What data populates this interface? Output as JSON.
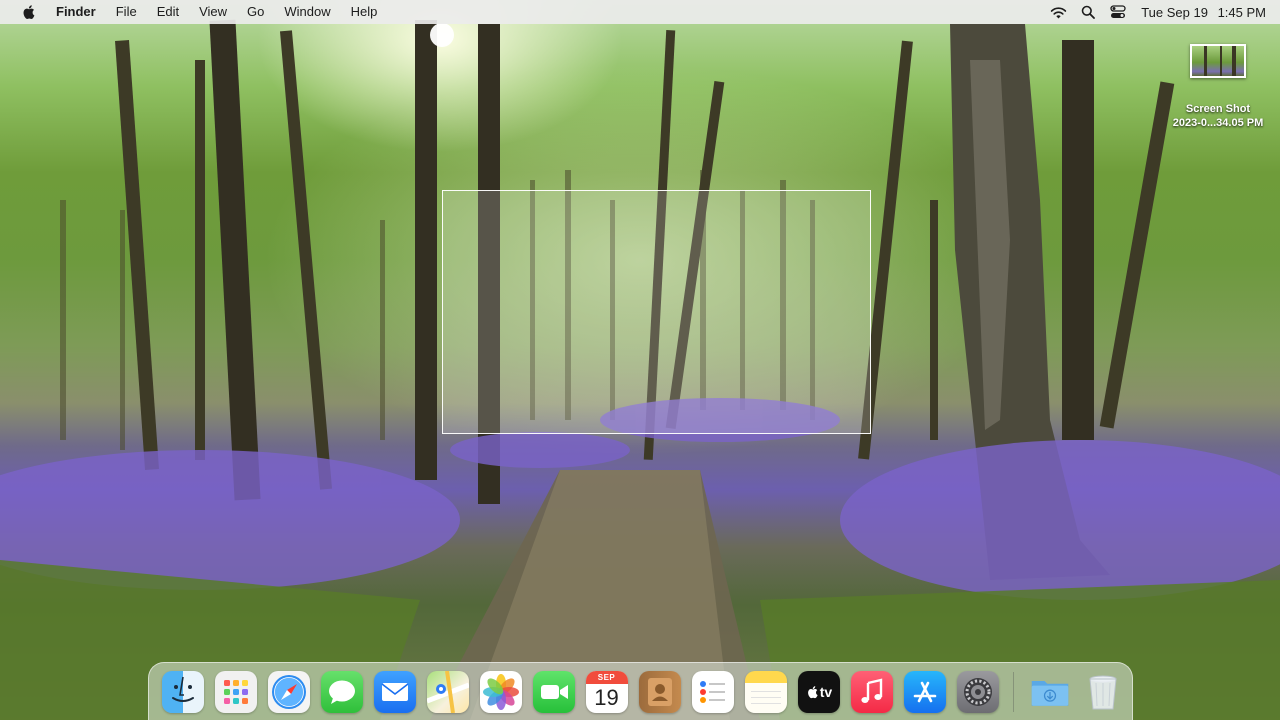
{
  "menubar": {
    "apple_icon": "apple-logo-icon",
    "app_name": "Finder",
    "menus": [
      "File",
      "Edit",
      "View",
      "Go",
      "Window",
      "Help"
    ],
    "status_icons": [
      "wifi-icon",
      "search-icon",
      "control-center-icon"
    ],
    "date": "Tue Sep 19",
    "time": "1:45 PM"
  },
  "desktop": {
    "file": {
      "icon": "screenshot-thumbnail-icon",
      "label_line1": "Screen Shot",
      "label_line2": "2023-0...34.05 PM"
    }
  },
  "dock": {
    "apps": [
      {
        "id": "finder",
        "icon": "finder-icon"
      },
      {
        "id": "launchpad",
        "icon": "launchpad-icon"
      },
      {
        "id": "safari",
        "icon": "safari-icon"
      },
      {
        "id": "messages",
        "icon": "messages-icon"
      },
      {
        "id": "mail",
        "icon": "mail-icon"
      },
      {
        "id": "maps",
        "icon": "maps-icon"
      },
      {
        "id": "photos",
        "icon": "photos-icon"
      },
      {
        "id": "facetime",
        "icon": "facetime-icon"
      },
      {
        "id": "calendar",
        "icon": "calendar-icon"
      },
      {
        "id": "contacts",
        "icon": "contacts-icon"
      },
      {
        "id": "reminders",
        "icon": "reminders-icon"
      },
      {
        "id": "notes",
        "icon": "notes-icon"
      },
      {
        "id": "tv",
        "icon": "apple-tv-icon"
      },
      {
        "id": "music",
        "icon": "music-icon"
      },
      {
        "id": "appstore",
        "icon": "app-store-icon"
      },
      {
        "id": "settings",
        "icon": "system-settings-icon"
      }
    ],
    "calendar": {
      "month": "SEP",
      "day": "19"
    },
    "tv_label": "tv",
    "downloads_icon": "downloads-folder-icon",
    "trash_icon": "trash-icon"
  },
  "colors": {
    "menubar_bg": "#ececec",
    "selection_border": "#ffffff",
    "bluebell": "#6c5fae",
    "foliage": "#6f9c3a"
  }
}
